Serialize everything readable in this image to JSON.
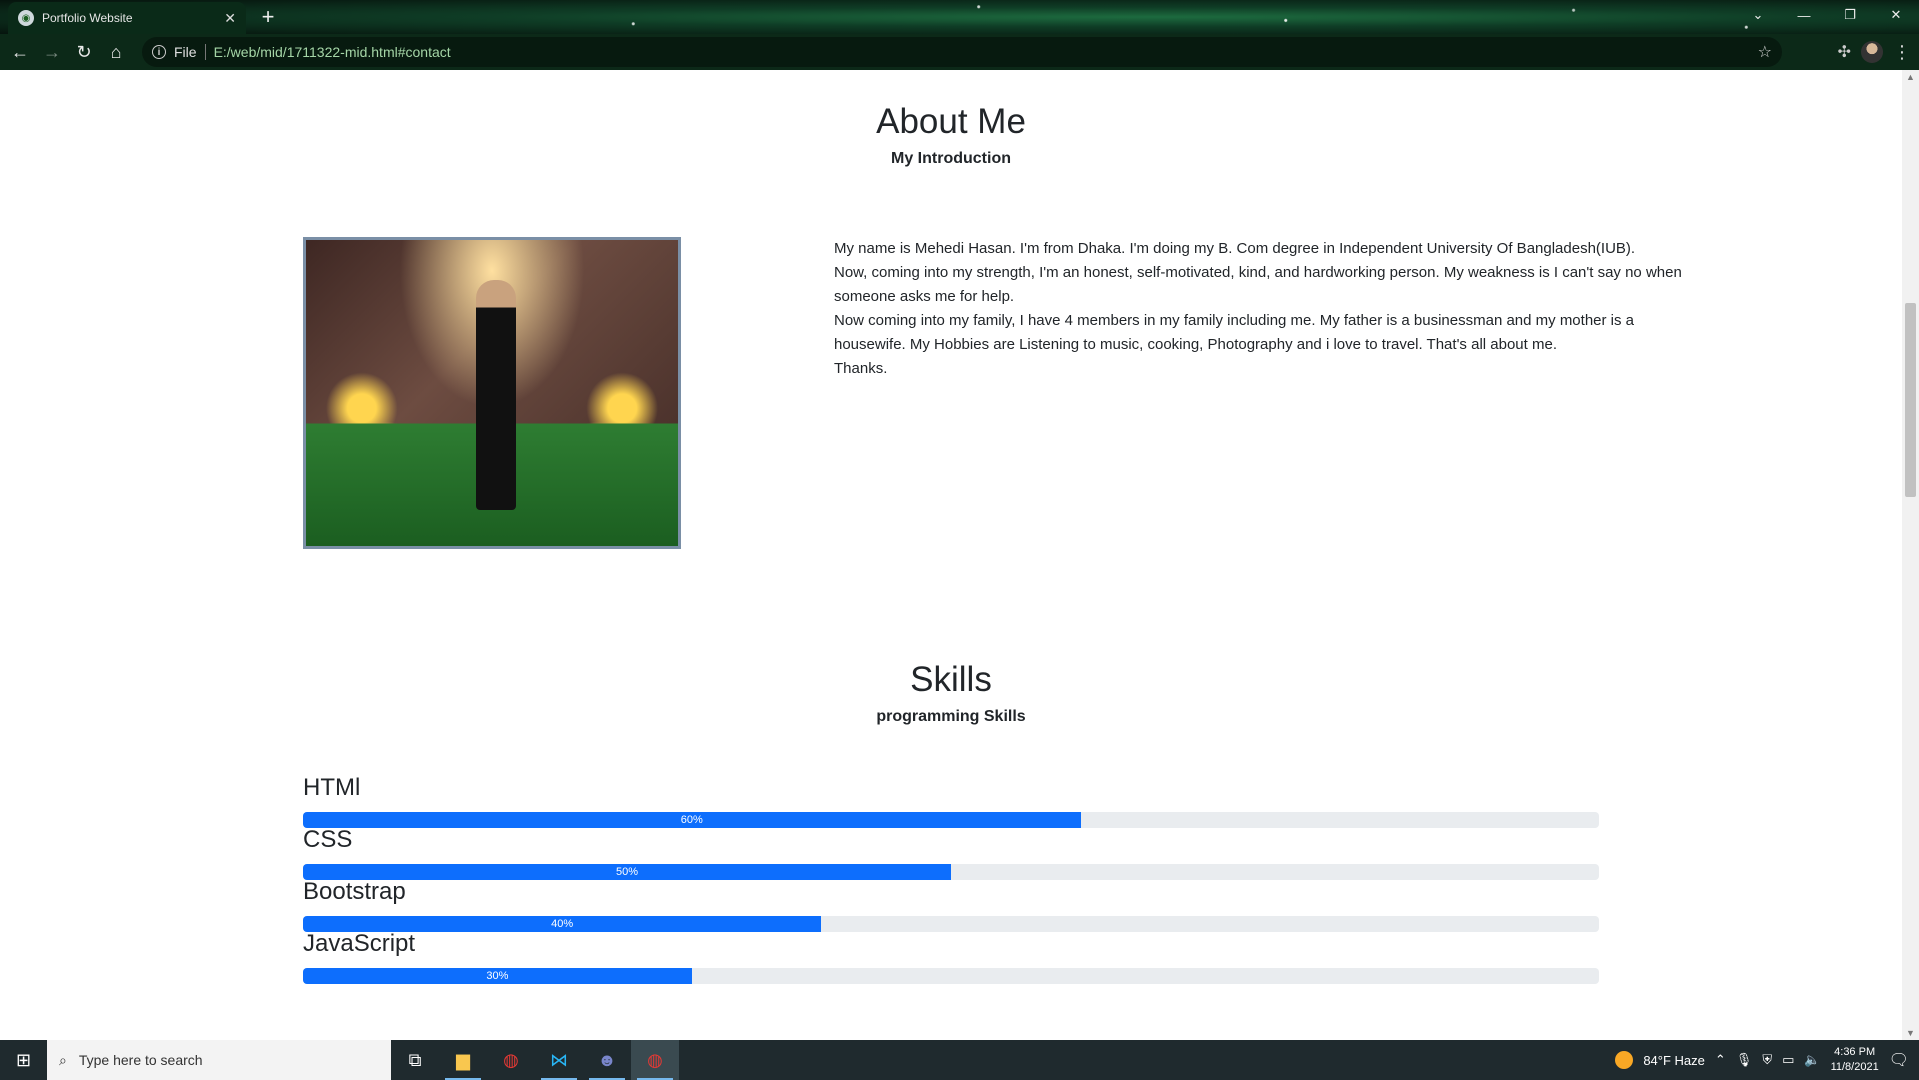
{
  "browser": {
    "tab_title": "Portfolio Website",
    "tab_close": "✕",
    "new_tab": "+",
    "url_scheme": "File",
    "url": "E:/web/mid/1711322-mid.html#contact",
    "minimize": "—",
    "restore": "❐",
    "close": "✕",
    "tab_list": "⌄"
  },
  "about": {
    "title": "About Me",
    "subtitle": "My Introduction",
    "paragraphs": [
      "My name is Mehedi Hasan. I'm from Dhaka. I'm doing my B. Com degree in Independent University Of Bangladesh(IUB).",
      "Now, coming into my strength, I'm an honest, self-motivated, kind, and hardworking person. My weakness is I can't say no when someone asks me for help.",
      "Now coming into my family, I have 4 members in my family including me. My father is a businessman and my mother is a housewife. My Hobbies are Listening to music, cooking, Photography and i love to travel. That's all about me.",
      "Thanks."
    ]
  },
  "skills": {
    "title": "Skills",
    "subtitle": "programming Skills",
    "items": [
      {
        "name": "HTMl",
        "percent": 60,
        "label": "60%"
      },
      {
        "name": "CSS",
        "percent": 50,
        "label": "50%"
      },
      {
        "name": "Bootstrap",
        "percent": 40,
        "label": "40%"
      },
      {
        "name": "JavaScript",
        "percent": 30,
        "label": "30%"
      }
    ]
  },
  "colors": {
    "progress_fill": "#0d6efd",
    "progress_track": "#e9ecef"
  },
  "taskbar": {
    "search_placeholder": "Type here to search",
    "weather": "84°F  Haze",
    "time": "4:36 PM",
    "date": "11/8/2021"
  }
}
